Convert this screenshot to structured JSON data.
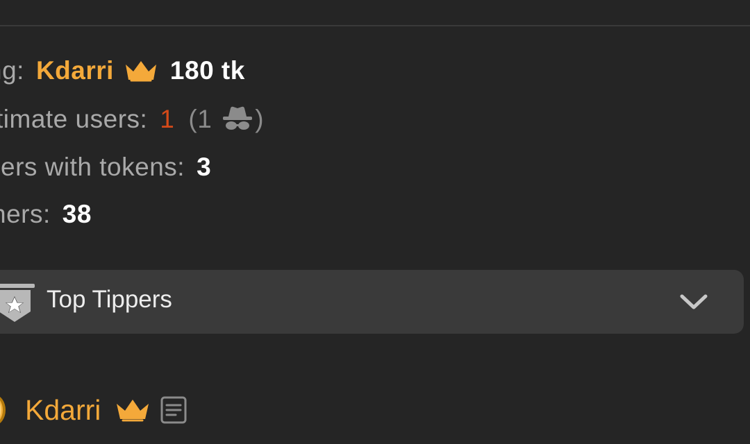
{
  "stats": {
    "top_tipper": {
      "label": "ng:",
      "name": "Kdarri",
      "amount": "180 tk"
    },
    "legit_users": {
      "label": "timate users:",
      "count": "1",
      "paren_open": "(",
      "anon_count": "1",
      "paren_close": ")"
    },
    "users_with_tokens": {
      "label": "sers with tokens:",
      "value": "3"
    },
    "watchers": {
      "label": "hers:",
      "value": "38"
    }
  },
  "top_tippers": {
    "title": "Top Tippers"
  },
  "tipper_list": [
    {
      "name": "Kdarri"
    }
  ],
  "icons": {
    "crown": "crown-icon",
    "anonymous": "incognito-icon",
    "badge": "star-badge-icon",
    "chevron": "chevron-down-icon",
    "coin": "coin-icon",
    "notes": "notes-icon"
  },
  "colors": {
    "background": "#252525",
    "accent_gold": "#f4a93a",
    "legit_orange": "#d54a19",
    "panel": "#3a3a3a"
  }
}
